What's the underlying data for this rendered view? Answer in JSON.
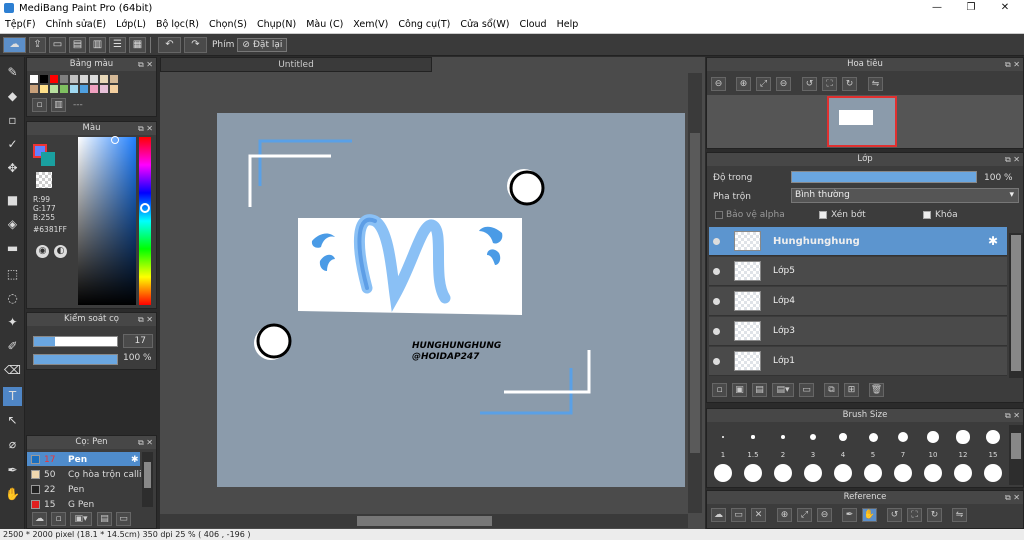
{
  "window": {
    "title": "MediBang Paint Pro (64bit)",
    "minimize": "—",
    "restore": "❐",
    "close": "✕"
  },
  "menu": [
    "Tệp(F)",
    "Chỉnh sửa(E)",
    "Lớp(L)",
    "Bộ lọc(R)",
    "Chọn(S)",
    "Chụp(N)",
    "Màu (C)",
    "Xem(V)",
    "Công cụ(T)",
    "Cửa sổ(W)",
    "Cloud",
    "Help"
  ],
  "toolbar": {
    "key_label": "Phím",
    "reset_label": "Đặt lại"
  },
  "palette": {
    "title": "Bảng màu",
    "footer": "---",
    "colors": [
      "#ffffff",
      "#000000",
      "#ff0000",
      "#808080",
      "#c0c0c0",
      "#d6d6d6",
      "#dcdcdc",
      "#e8d8b8",
      "#d4b896",
      "#c8a07a",
      "#ffe08a",
      "#b8e0a0",
      "#7fc060",
      "#a0d8f0",
      "#4fa0e0",
      "#f0a0c0",
      "#e6c0d8",
      "#f5d0a0"
    ]
  },
  "color": {
    "title": "Màu",
    "r": "R:99",
    "g": "G:177",
    "b": "B:255",
    "hex": "#6381FF",
    "main": "#6381ff",
    "sub": "#1aa0a0"
  },
  "brush_control": {
    "title": "Kiểm soát cọ",
    "size": "17",
    "opacity": "100 %",
    "size_fill": 0.25,
    "opacity_fill": 1.0
  },
  "brush_list": {
    "title": "Cọ: Pen",
    "items": [
      {
        "size": "17",
        "name": "Pen",
        "color": "#1a6fc0",
        "active": true
      },
      {
        "size": "50",
        "name": "Cọ hòa trộn calli",
        "color": "#f0d8b0",
        "active": false
      },
      {
        "size": "22",
        "name": "Pen",
        "color": "#222222",
        "active": false
      },
      {
        "size": "15",
        "name": "G Pen",
        "color": "#e02020",
        "active": false
      }
    ]
  },
  "document": {
    "tab": "Untitled"
  },
  "artwork": {
    "watermark_line1": "HUNGHUNGHUNG",
    "watermark_line2": "@HOIDAP247"
  },
  "navigator": {
    "title": "Hoa tiêu"
  },
  "layer_panel": {
    "title": "Lớp",
    "opacity_label": "Độ trong",
    "opacity_value": "100 %",
    "opacity_fill": 1.0,
    "blend_label": "Pha trộn",
    "blend_value": "Bình thường",
    "protect_alpha": "Bảo vệ alpha",
    "clipping": "Xén bớt",
    "lock": "Khóa",
    "layers": [
      {
        "name": "Hunghunghung",
        "active": true
      },
      {
        "name": "Lớp5",
        "active": false
      },
      {
        "name": "Lớp4",
        "active": false
      },
      {
        "name": "Lớp3",
        "active": false
      },
      {
        "name": "Lớp1",
        "active": false
      }
    ]
  },
  "brush_size": {
    "title": "Brush Size",
    "sizes": [
      "1",
      "1.5",
      "2",
      "3",
      "4",
      "5",
      "7",
      "10",
      "12",
      "15"
    ]
  },
  "reference": {
    "title": "Reference"
  },
  "status": {
    "text": "2500 * 2000 pixel  (18.1 * 14.5cm)  350 dpi  25 %  ( 406 , -196 )"
  }
}
